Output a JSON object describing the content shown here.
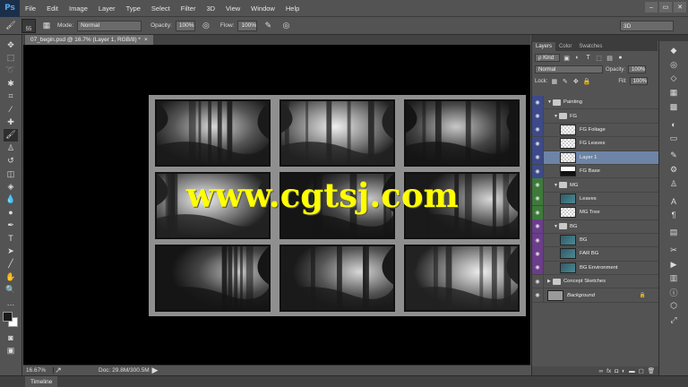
{
  "app": {
    "logo": "Ps"
  },
  "menu": [
    "File",
    "Edit",
    "Image",
    "Layer",
    "Type",
    "Select",
    "Filter",
    "3D",
    "View",
    "Window",
    "Help"
  ],
  "window_controls": [
    "–",
    "▭",
    "✕"
  ],
  "options": {
    "brush_size": "55",
    "mode_label": "Mode:",
    "mode_value": "Normal",
    "opacity_label": "Opacity:",
    "opacity_value": "100%",
    "flow_label": "Flow:",
    "flow_value": "100%",
    "workspace": "3D"
  },
  "document": {
    "tab_title": "07_begin.psd @ 16.7% (Layer 1, RGB/8) *",
    "close": "×"
  },
  "watermark": "www.cgtsj.com",
  "status": {
    "zoom": "16.67%",
    "doc_size": "Doc: 29.8M/300.5M"
  },
  "timeline": {
    "label": "Timeline"
  },
  "layers_panel": {
    "tabs": [
      "Layers",
      "Color",
      "Swatches"
    ],
    "kind": "ρ Kind",
    "blend_mode": "Normal",
    "opacity_label": "Opacity:",
    "opacity_value": "100%",
    "lock_label": "Lock:",
    "fill_label": "Fill:",
    "fill_value": "100%",
    "layers": [
      {
        "name": "Painting",
        "type": "group",
        "indent": 0,
        "tag": "blue"
      },
      {
        "name": "FG",
        "type": "group",
        "indent": 1,
        "tag": "blue"
      },
      {
        "name": "FG Foliage",
        "type": "layer",
        "indent": 2,
        "tag": "blue",
        "thumb": "checker"
      },
      {
        "name": "FG Leaves",
        "type": "layer",
        "indent": 2,
        "tag": "blue",
        "thumb": "checker"
      },
      {
        "name": "Layer 1",
        "type": "layer",
        "indent": 2,
        "tag": "blue",
        "thumb": "checker",
        "selected": true
      },
      {
        "name": "FG Base",
        "type": "layer",
        "indent": 2,
        "tag": "blue",
        "thumb": "dark"
      },
      {
        "name": "MG",
        "type": "group",
        "indent": 1,
        "tag": "green"
      },
      {
        "name": "Leaves",
        "type": "layer",
        "indent": 2,
        "tag": "green",
        "thumb": "teal"
      },
      {
        "name": "MG Tree",
        "type": "layer",
        "indent": 2,
        "tag": "green",
        "thumb": "checker"
      },
      {
        "name": "BG",
        "type": "group",
        "indent": 1,
        "tag": "purple"
      },
      {
        "name": "BG",
        "type": "layer",
        "indent": 2,
        "tag": "purple",
        "thumb": "teal"
      },
      {
        "name": "FAR BG",
        "type": "layer",
        "indent": 2,
        "tag": "purple",
        "thumb": "teal"
      },
      {
        "name": "BG Environment",
        "type": "layer",
        "indent": 2,
        "tag": "purple",
        "thumb": "teal"
      },
      {
        "name": "Concept Sketches",
        "type": "group",
        "indent": 0,
        "tag": "gray"
      },
      {
        "name": "Background",
        "type": "layer",
        "indent": 0,
        "tag": "gray",
        "thumb": "gray"
      }
    ],
    "footer_icons": [
      "link-icon",
      "fx-icon",
      "mask-icon",
      "adjustment-icon",
      "folder-icon",
      "new-layer-icon",
      "trash-icon"
    ]
  },
  "colors": {
    "accent": "#6d84a6",
    "canvas": "#000000",
    "panel": "#535353",
    "watermark": "#ffff00"
  }
}
